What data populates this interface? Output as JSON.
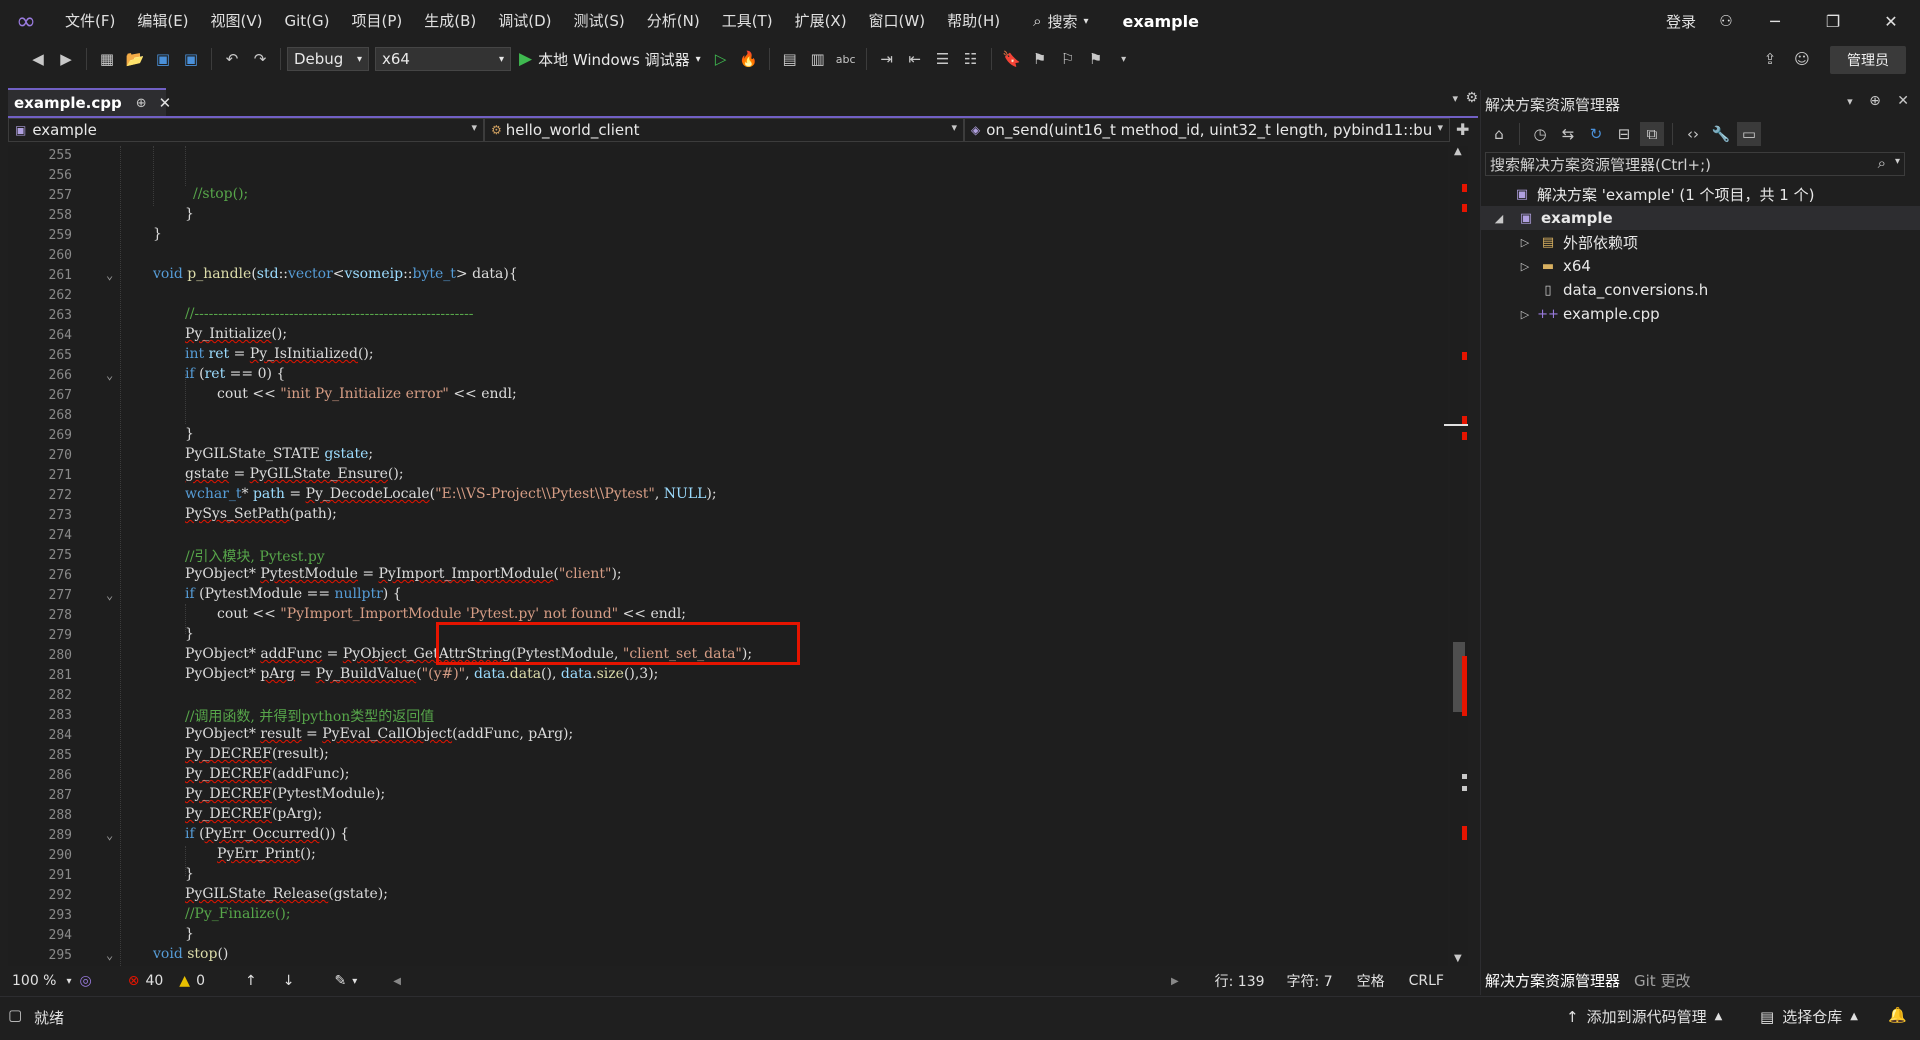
{
  "menu": {
    "items": [
      "文件(F)",
      "编辑(E)",
      "视图(V)",
      "Git(G)",
      "项目(P)",
      "生成(B)",
      "调试(D)",
      "测试(S)",
      "分析(N)",
      "工具(T)",
      "扩展(X)",
      "窗口(W)",
      "帮助(H)"
    ],
    "search_label": "搜索",
    "solution_name": "example",
    "login_label": "登录"
  },
  "toolbar": {
    "config": "Debug",
    "platform": "x64",
    "run_label": "本地 Windows 调试器",
    "admin_label": "管理员"
  },
  "editor": {
    "tab_label": "example.cpp",
    "nav_project": "example",
    "nav_class": "hello_world_client",
    "nav_member": "on_send(uint16_t method_id, uint32_t length, pybind11::bu"
  },
  "code": {
    "line_numbers": [
      "255",
      "256",
      "257",
      "258",
      "259",
      "260",
      "261",
      "262",
      "263",
      "264",
      "265",
      "266",
      "267",
      "268",
      "269",
      "270",
      "271",
      "272",
      "273",
      "274",
      "275",
      "276",
      "277",
      "278",
      "279",
      "280",
      "281",
      "282",
      "283",
      "284",
      "285",
      "286",
      "287",
      "288",
      "289",
      "290",
      "291",
      "292",
      "293",
      "294",
      "295"
    ]
  },
  "editor_status": {
    "zoom": "100 %",
    "errors": "40",
    "warnings": "0",
    "line": "行: 139",
    "col": "字符: 7",
    "spaces": "空格",
    "eol": "CRLF"
  },
  "solution_explorer": {
    "title": "解决方案资源管理器",
    "search_placeholder": "搜索解决方案资源管理器(Ctrl+;)",
    "solution_label": "解决方案 'example' (1 个项目，共 1 个)",
    "project_label": "example",
    "items": [
      "外部依赖项",
      "x64",
      "data_conversions.h",
      "example.cpp"
    ],
    "bottom_tab_1": "解决方案资源管理器",
    "bottom_tab_2": "Git 更改"
  },
  "status_bar": {
    "ready": "就绪",
    "add_source_control": "添加到源代码管理",
    "select_repo": "选择仓库"
  },
  "colors": {
    "accent": "#7160c4",
    "error_red": "#e51400",
    "keyword": "#569cd6",
    "comment": "#57a64a",
    "string": "#d69d85"
  }
}
